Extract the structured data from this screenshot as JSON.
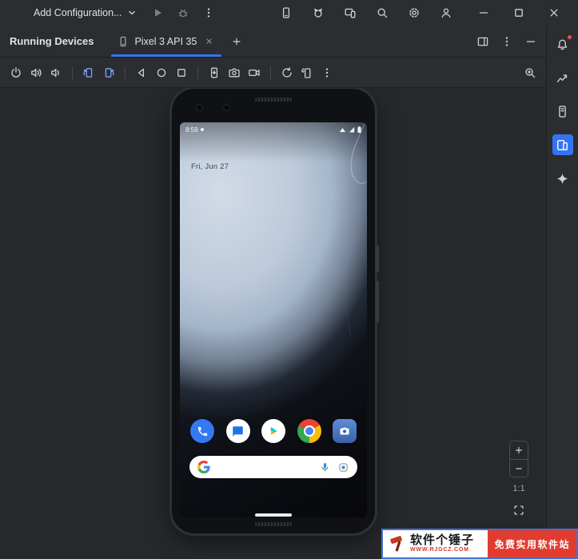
{
  "app": {
    "titlebar": {
      "run_config_label": "Add Configuration...",
      "left_icons": [
        "chevron-down",
        "run-play",
        "debug-bug",
        "more-vertical"
      ],
      "center_icons": [
        "device-manager",
        "logcat",
        "device-mirror",
        "search",
        "settings",
        "profile"
      ],
      "window_controls": [
        "minimize",
        "maximize",
        "close"
      ]
    },
    "panel": {
      "title": "Running Devices"
    },
    "tabs": {
      "active_tab": {
        "label": "Pixel 3 API 35",
        "icon": "phone",
        "closable": true
      },
      "new_tab_icon": "plus"
    },
    "tab_right_icons": [
      "window-layout",
      "more-vertical",
      "hide"
    ],
    "stripe_icons": [
      "notifications-bell",
      "profiler-chart",
      "device-explorer",
      "running-devices-selected",
      "gemini-sparkle"
    ],
    "device_toolbar_icons": [
      "power",
      "volume-up",
      "volume-down",
      "rotate-left",
      "rotate-right",
      "back",
      "home",
      "overview",
      "snapshot",
      "screenshot-camera",
      "screen-record",
      "reset",
      "device-connection",
      "more-vertical",
      "screenshot-zoom"
    ]
  },
  "emulator": {
    "status_time": "8:59",
    "lock_date": "Fri, Jun 27",
    "dock_apps": [
      "Phone",
      "Messages",
      "Play Store",
      "Chrome",
      "Camera"
    ],
    "search_provider_letter": "G",
    "search_icons": [
      "google-g",
      "mic",
      "lens"
    ]
  },
  "zoom_controls": {
    "scale_label": "1:1",
    "icons": [
      "zoom-in",
      "zoom-out",
      "fit-screen"
    ]
  },
  "watermark": {
    "site_name": "软件个锤子",
    "site_url": "WWW.RJGCZ.COM",
    "tagline": "免费实用软件站"
  },
  "colors": {
    "accent_blue": "#3574f0",
    "badge_red": "#ec4b4b",
    "watermark_red": "#e23c31",
    "toolbar_bg": "#2b2d30",
    "viewport_bg": "#26282c"
  }
}
